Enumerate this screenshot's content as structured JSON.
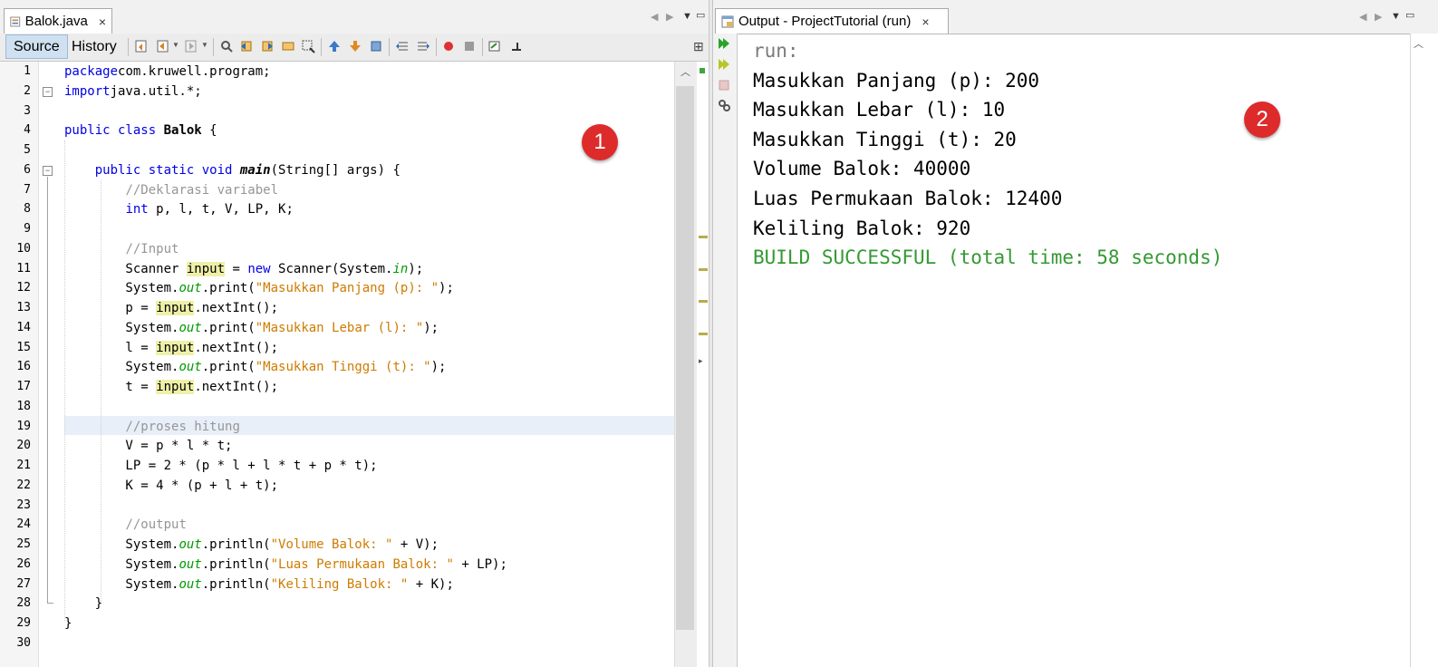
{
  "editor": {
    "tab_title": "Balok.java",
    "tab_close": "×",
    "view_source": "Source",
    "view_history": "History",
    "lines": [
      {
        "n": "1"
      },
      {
        "n": "2"
      },
      {
        "n": "3"
      },
      {
        "n": "4"
      },
      {
        "n": "5"
      },
      {
        "n": "6"
      },
      {
        "n": "7"
      },
      {
        "n": "8"
      },
      {
        "n": "9"
      },
      {
        "n": "10"
      },
      {
        "n": "11"
      },
      {
        "n": "12"
      },
      {
        "n": "13"
      },
      {
        "n": "14"
      },
      {
        "n": "15"
      },
      {
        "n": "16"
      },
      {
        "n": "17"
      },
      {
        "n": "18"
      },
      {
        "n": "19"
      },
      {
        "n": "20"
      },
      {
        "n": "21"
      },
      {
        "n": "22"
      },
      {
        "n": "23"
      },
      {
        "n": "24"
      },
      {
        "n": "25"
      },
      {
        "n": "26"
      },
      {
        "n": "27"
      },
      {
        "n": "28"
      },
      {
        "n": "29"
      },
      {
        "n": "30"
      }
    ],
    "code": [
      [
        [
          "kw",
          "package"
        ],
        [
          "",
          "com.kruwell.program;"
        ]
      ],
      [
        [
          "kw",
          "import"
        ],
        [
          "",
          "java.util.*;"
        ]
      ],
      [],
      [
        [
          "kw",
          "public class"
        ],
        [
          "",
          " "
        ],
        [
          "cls",
          "Balok"
        ],
        [
          "",
          " {"
        ]
      ],
      [],
      [
        [
          "",
          "    "
        ],
        [
          "kw",
          "public static void"
        ],
        [
          "",
          " "
        ],
        [
          "mth",
          "main"
        ],
        [
          "",
          "(String[] args) {"
        ]
      ],
      [
        [
          "",
          "        "
        ],
        [
          "cm",
          "//Deklarasi variabel"
        ]
      ],
      [
        [
          "",
          "        "
        ],
        [
          "kw",
          "int"
        ],
        [
          "",
          " p, l, t, V, LP, K;"
        ]
      ],
      [],
      [
        [
          "",
          "        "
        ],
        [
          "cm",
          "//Input"
        ]
      ],
      [
        [
          "",
          "        Scanner "
        ],
        [
          "hl",
          "input"
        ],
        [
          "",
          " = "
        ],
        [
          "kw",
          "new"
        ],
        [
          "",
          " Scanner(System."
        ],
        [
          "fld",
          "in"
        ],
        [
          "",
          ");"
        ]
      ],
      [
        [
          "",
          "        System."
        ],
        [
          "fld",
          "out"
        ],
        [
          "",
          ".print("
        ],
        [
          "st",
          "\"Masukkan Panjang (p): \""
        ],
        [
          "",
          ");"
        ]
      ],
      [
        [
          "",
          "        p = "
        ],
        [
          "hl",
          "input"
        ],
        [
          "",
          ".nextInt();"
        ]
      ],
      [
        [
          "",
          "        System."
        ],
        [
          "fld",
          "out"
        ],
        [
          "",
          ".print("
        ],
        [
          "st",
          "\"Masukkan Lebar (l): \""
        ],
        [
          "",
          ");"
        ]
      ],
      [
        [
          "",
          "        l = "
        ],
        [
          "hl",
          "input"
        ],
        [
          "",
          ".nextInt();"
        ]
      ],
      [
        [
          "",
          "        System."
        ],
        [
          "fld",
          "out"
        ],
        [
          "",
          ".print("
        ],
        [
          "st",
          "\"Masukkan Tinggi (t): \""
        ],
        [
          "",
          ");"
        ]
      ],
      [
        [
          "",
          "        t = "
        ],
        [
          "hl",
          "input"
        ],
        [
          "",
          ".nextInt();"
        ]
      ],
      [],
      [
        [
          "",
          "        "
        ],
        [
          "cm",
          "//proses hitung"
        ]
      ],
      [
        [
          "",
          "        V = p * l * t;"
        ]
      ],
      [
        [
          "",
          "        LP = 2 * (p * l + l * t + p * t);"
        ]
      ],
      [
        [
          "",
          "        K = 4 * (p + l + t);"
        ]
      ],
      [],
      [
        [
          "",
          "        "
        ],
        [
          "cm",
          "//output"
        ]
      ],
      [
        [
          "",
          "        System."
        ],
        [
          "fld",
          "out"
        ],
        [
          "",
          ".println("
        ],
        [
          "st",
          "\"Volume Balok: \""
        ],
        [
          "",
          " + V);"
        ]
      ],
      [
        [
          "",
          "        System."
        ],
        [
          "fld",
          "out"
        ],
        [
          "",
          ".println("
        ],
        [
          "st",
          "\"Luas Permukaan Balok: \""
        ],
        [
          "",
          " + LP);"
        ]
      ],
      [
        [
          "",
          "        System."
        ],
        [
          "fld",
          "out"
        ],
        [
          "",
          ".println("
        ],
        [
          "st",
          "\"Keliling Balok: \""
        ],
        [
          "",
          " + K);"
        ]
      ],
      [
        [
          "",
          "    }"
        ]
      ],
      [
        [
          "",
          "}"
        ]
      ],
      []
    ]
  },
  "output": {
    "tab_title": "Output - ProjectTutorial (run)",
    "tab_close": "×",
    "lines": [
      {
        "text": "run:",
        "color": "#7a7a7a"
      },
      {
        "text": "Masukkan Panjang (p): 200",
        "color": "#000000"
      },
      {
        "text": "Masukkan Lebar (l): 10",
        "color": "#000000"
      },
      {
        "text": "Masukkan Tinggi (t): 20",
        "color": "#000000"
      },
      {
        "text": "Volume Balok: 40000",
        "color": "#000000"
      },
      {
        "text": "Luas Permukaan Balok: 12400",
        "color": "#000000"
      },
      {
        "text": "Keliling Balok: 920",
        "color": "#000000"
      },
      {
        "text": "BUILD SUCCESSFUL (total time: 58 seconds)",
        "color": "#339933"
      }
    ]
  },
  "badges": {
    "one": "1",
    "two": "2"
  }
}
